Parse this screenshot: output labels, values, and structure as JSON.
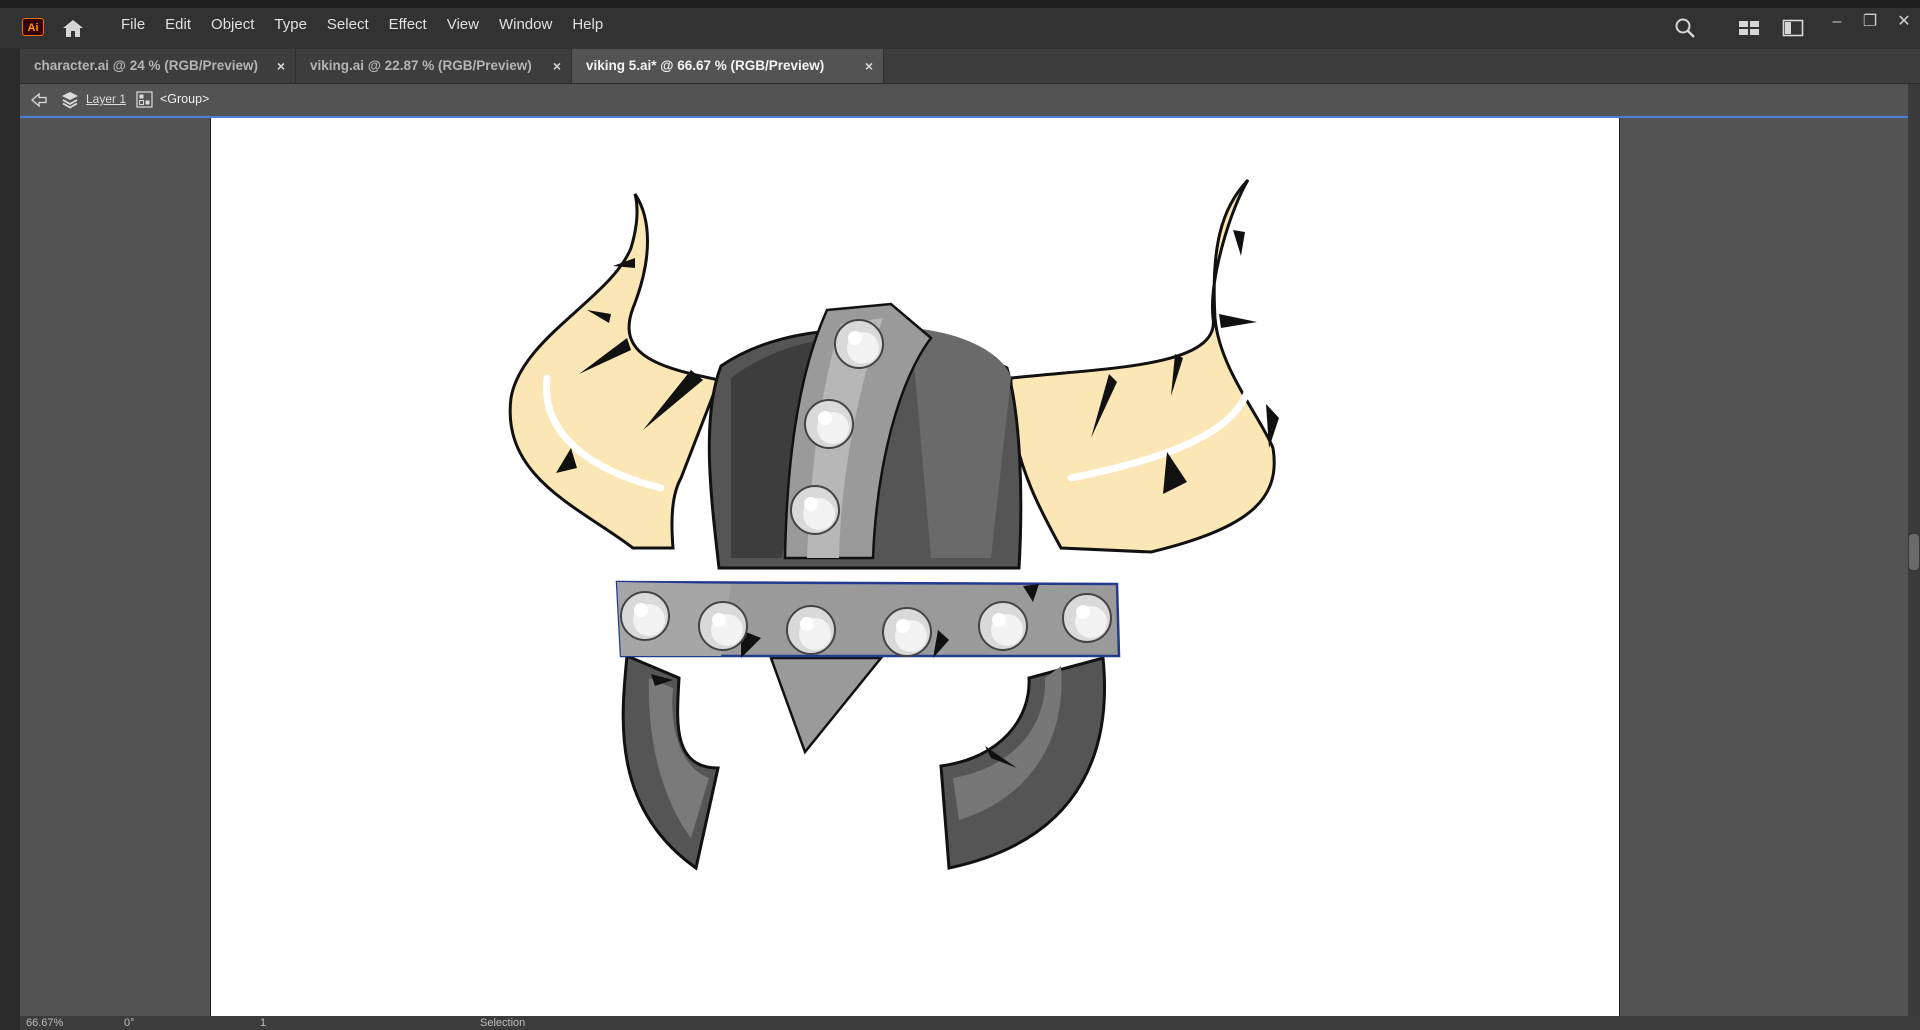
{
  "app": {
    "logo_text": "Ai"
  },
  "menu": {
    "items": [
      "File",
      "Edit",
      "Object",
      "Type",
      "Select",
      "Effect",
      "View",
      "Window",
      "Help"
    ]
  },
  "window_controls": {
    "minimize": "–",
    "restore": "❐",
    "close": "✕"
  },
  "tabs": [
    {
      "label": "character.ai @ 24 % (RGB/Preview)",
      "active": false,
      "close": "×"
    },
    {
      "label": "viking.ai @ 22.87 % (RGB/Preview)",
      "active": false,
      "close": "×"
    },
    {
      "label": "viking 5.ai* @ 66.67 % (RGB/Preview)",
      "active": true,
      "close": "×"
    }
  ],
  "breadcrumb": {
    "layer": "Layer 1",
    "group": "<Group>"
  },
  "statusbar": {
    "zoom": "66.67%",
    "rotation": "0°",
    "artboard": "1",
    "tool": "Selection"
  },
  "colors": {
    "chrome_dark": "#323232",
    "chrome_mid": "#535353",
    "selection_blue": "#4a7fdd",
    "horn": "#fbe7b5",
    "helmet_dark": "#4a4a4a",
    "helmet_band": "#9a9a9a"
  },
  "icons": {
    "home": "home-icon",
    "search": "search-icon",
    "workspace": "workspace-switcher-icon",
    "arrange": "arrange-documents-icon",
    "layers": "layers-icon",
    "back": "back-arrow-icon"
  }
}
